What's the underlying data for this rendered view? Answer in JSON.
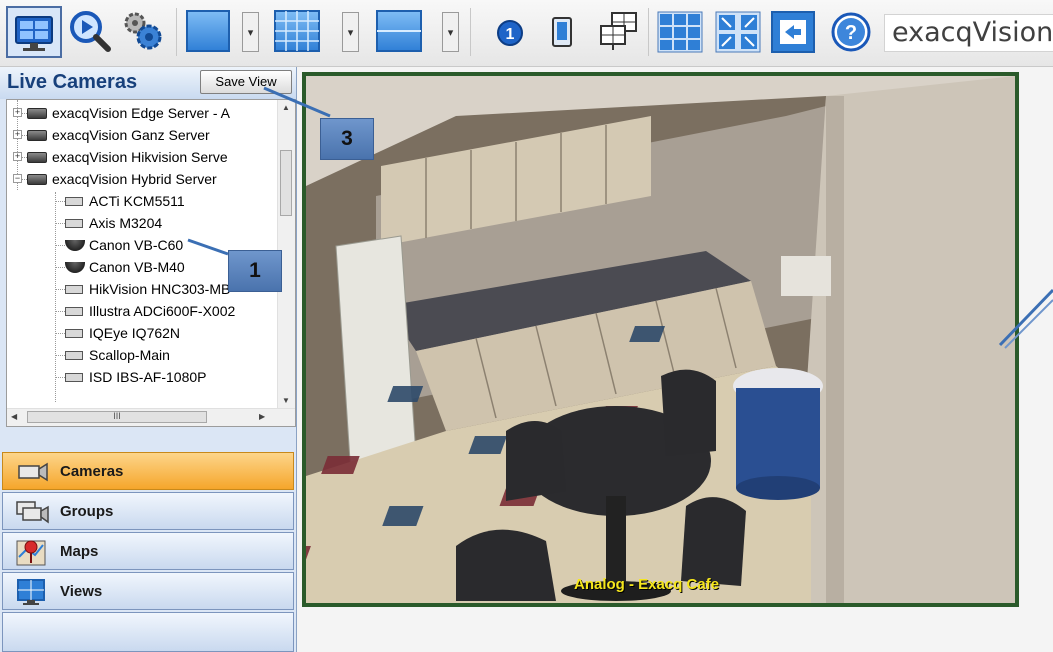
{
  "toolbar": {
    "buttons": [
      {
        "icon": "monitor-icon",
        "selected": true
      },
      {
        "icon": "search-icon"
      },
      {
        "icon": "gears-icon"
      },
      {
        "icon": "single-layout-icon"
      },
      {
        "icon": "grid-layout-icon"
      },
      {
        "icon": "split-layout-icon"
      },
      {
        "icon": "number-one-icon"
      },
      {
        "icon": "tour-icon"
      },
      {
        "icon": "multi-monitor-icon"
      },
      {
        "icon": "tile-arrows-icon"
      },
      {
        "icon": "expand-icon"
      },
      {
        "icon": "back-icon"
      },
      {
        "icon": "help-icon"
      }
    ],
    "one_label": "1",
    "help_label": "?",
    "brand": "exacqVision"
  },
  "sidebar": {
    "title": "Live Cameras",
    "save_view": "Save View",
    "tree": [
      {
        "label": "exacqVision Edge Server - A",
        "type": "server",
        "expanded": false
      },
      {
        "label": "exacqVision Ganz Server",
        "type": "server",
        "expanded": false
      },
      {
        "label": "exacqVision Hikvision Serve",
        "type": "server",
        "expanded": false
      },
      {
        "label": "exacqVision Hybrid Server",
        "type": "server",
        "expanded": true
      },
      {
        "label": "ACTi KCM5511",
        "type": "camera"
      },
      {
        "label": "Axis M3204",
        "type": "camera"
      },
      {
        "label": "Canon VB-C60",
        "type": "dome"
      },
      {
        "label": "Canon VB-M40",
        "type": "dome"
      },
      {
        "label": "HikVision HNC303-MB",
        "type": "camera"
      },
      {
        "label": "Illustra ADCi600F-X002",
        "type": "camera"
      },
      {
        "label": "IQEye IQ762N",
        "type": "camera"
      },
      {
        "label": "Scallop-Main",
        "type": "camera"
      },
      {
        "label": "ISD IBS-AF-1080P",
        "type": "camera"
      }
    ],
    "scroll_grip": "III",
    "nav": [
      {
        "label": "Cameras",
        "icon": "camera-icon",
        "active": true
      },
      {
        "label": "Groups",
        "icon": "groups-icon",
        "active": false
      },
      {
        "label": "Maps",
        "icon": "map-icon",
        "active": false
      },
      {
        "label": "Views",
        "icon": "views-icon",
        "active": false
      }
    ]
  },
  "video": {
    "overlay": "Analog - Exacq Cafe"
  },
  "callouts": [
    "3",
    "1"
  ]
}
